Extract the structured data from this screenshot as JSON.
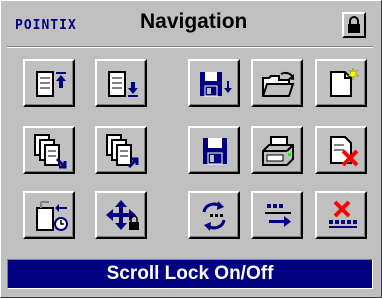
{
  "header": {
    "brand": "POINTIX",
    "title": "Navigation"
  },
  "toolbar": {
    "rows": [
      [
        "go-to-top-icon",
        "go-to-bottom-icon",
        "save-down-icon",
        "open-folder-icon",
        "new-document-icon"
      ],
      [
        "pages-next-icon",
        "pages-previous-icon",
        "save-icon",
        "print-icon",
        "close-document-icon"
      ],
      [
        "window-timer-icon",
        "move-lock-icon",
        "refresh-icon",
        "goto-arrow-icon",
        "delete-items-icon"
      ]
    ]
  },
  "status": {
    "text": "Scroll Lock On/Off"
  },
  "colors": {
    "face": "#c0c0c0",
    "brand": "#000080",
    "status_bg": "#000080",
    "accent_red": "#ff0000",
    "accent_yellow": "#ffff00"
  }
}
